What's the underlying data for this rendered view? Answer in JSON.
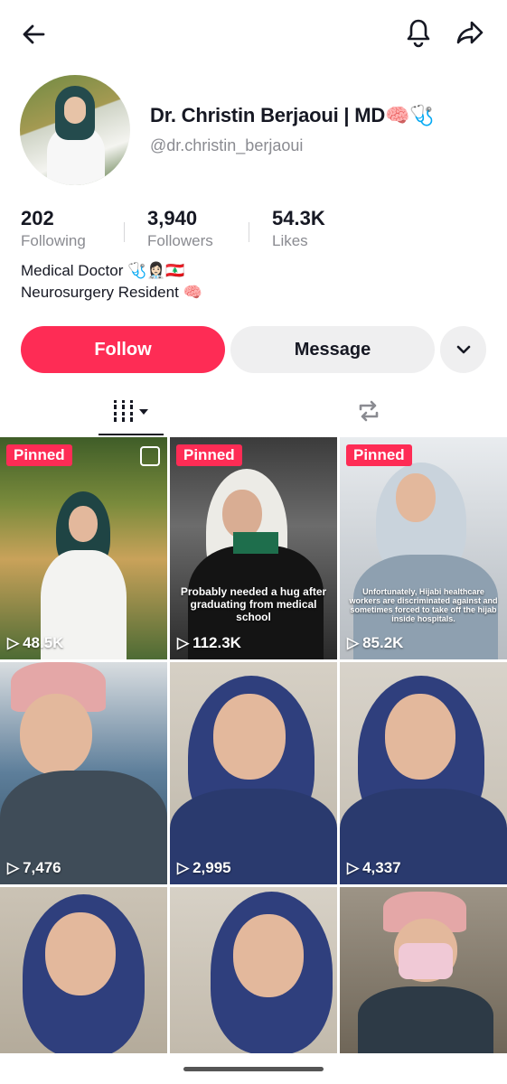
{
  "header": {
    "back_icon": "arrow-left-icon",
    "bell_icon": "bell-icon",
    "share_icon": "share-arrow-icon"
  },
  "profile": {
    "display_name": "Dr. Christin Berjaoui | MD🧠🩺",
    "handle": "@dr.christin_berjaoui",
    "stats": [
      {
        "value": "202",
        "label": "Following"
      },
      {
        "value": "3,940",
        "label": "Followers"
      },
      {
        "value": "54.3K",
        "label": "Likes"
      }
    ],
    "bio_line1": "Medical Doctor 🩺👩🏻‍⚕️🇱🇧",
    "bio_line2": "Neurosurgery Resident 🧠"
  },
  "actions": {
    "follow": "Follow",
    "message": "Message"
  },
  "tabs": {
    "videos_icon": "videos-grid-icon",
    "reposts_icon": "repost-icon"
  },
  "videos": [
    {
      "pinned": "Pinned",
      "views": "48.5K",
      "caption": ""
    },
    {
      "pinned": "Pinned",
      "views": "112.3K",
      "caption": "Probably needed a hug after graduating from medical school"
    },
    {
      "pinned": "Pinned",
      "views": "85.2K",
      "caption": "Unfortunately, Hijabi healthcare workers are discriminated against and sometimes forced to take off the hijab inside hospitals."
    },
    {
      "views": "7,476"
    },
    {
      "views": "2,995"
    },
    {
      "views": "4,337"
    },
    {
      "views": ""
    },
    {
      "views": ""
    },
    {
      "views": ""
    }
  ],
  "colors": {
    "accent": "#fe2c55",
    "text": "#161823",
    "muted": "#8a8b91"
  }
}
